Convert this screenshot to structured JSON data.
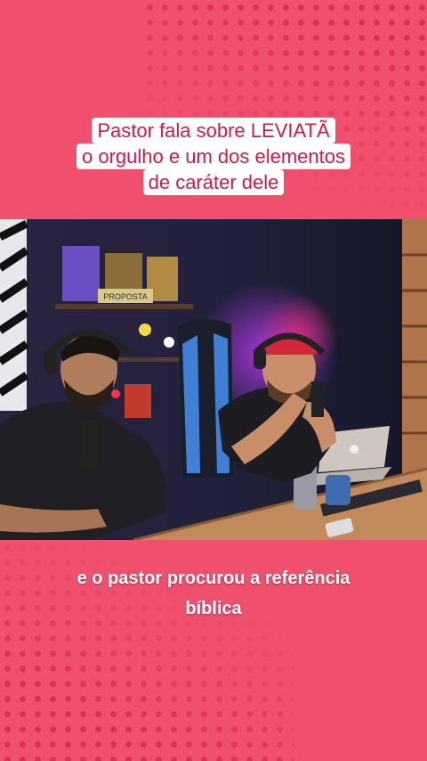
{
  "title": {
    "lines": [
      "Pastor fala sobre LEVIATÃ",
      "o orgulho e um dos elementos",
      "de caráter dele"
    ],
    "color": "#d2194a"
  },
  "video": {
    "shelf_sign": "PROPOSTA"
  },
  "caption": {
    "line1": "e o pastor procurou a referência",
    "line2": "bíblica"
  },
  "colors": {
    "background": "#f0506d",
    "dots": "#d9314f",
    "caption": "#ffffff"
  }
}
